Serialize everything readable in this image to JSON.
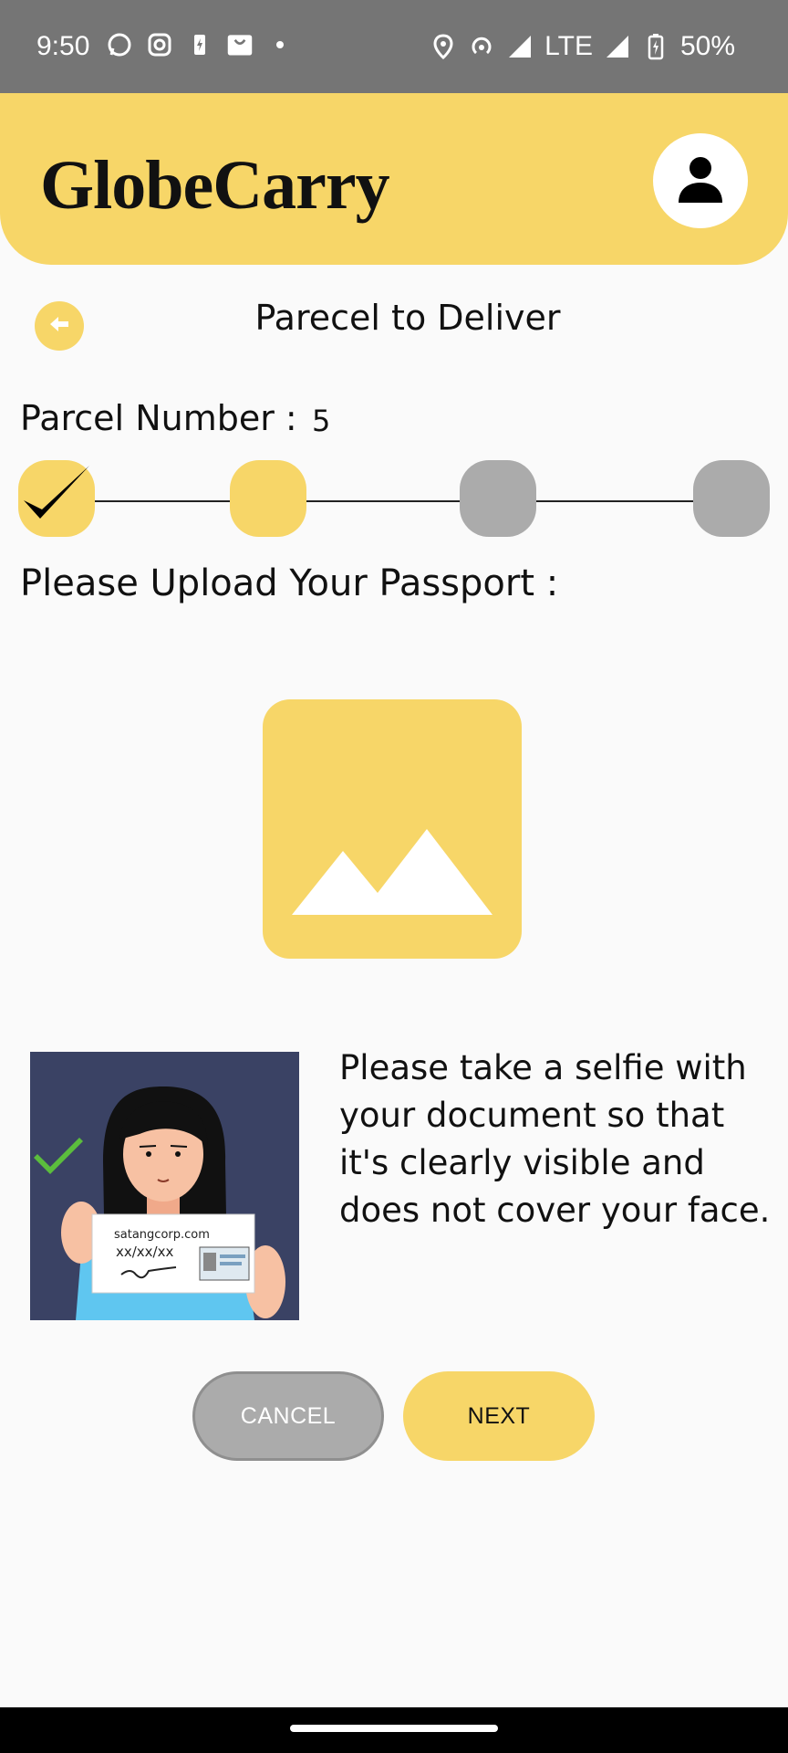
{
  "status_bar": {
    "time": "9:50",
    "network": "LTE",
    "battery": "50%",
    "left_icons": [
      "whatsapp-icon",
      "instagram-icon",
      "battery-saver-icon",
      "shopping-bag-icon",
      "dot-icon"
    ],
    "right_icons": [
      "location-icon",
      "hotspot-icon",
      "signal-icon",
      "signal-icon",
      "battery-icon"
    ]
  },
  "header": {
    "brand": "GlobeCarry",
    "avatar_icon": "person-icon"
  },
  "page": {
    "title": "Parecel to Deliver",
    "back_icon": "arrow-left-icon"
  },
  "parcel": {
    "label": "Parcel Number :",
    "number": "5"
  },
  "stepper": {
    "steps": [
      {
        "state": "completed"
      },
      {
        "state": "current"
      },
      {
        "state": "upcoming"
      },
      {
        "state": "upcoming"
      }
    ]
  },
  "upload": {
    "label": "Please Upload Your Passport :",
    "placeholder_icon": "image-placeholder-icon"
  },
  "selfie": {
    "instruction": "Please take a selfie with your document so that it's clearly visible and does not cover your face.",
    "card_site": "satangcorp.com",
    "card_date": "xx/xx/xx"
  },
  "buttons": {
    "cancel": "CANCEL",
    "next": "NEXT"
  },
  "colors": {
    "accent": "#f7d668",
    "inactive": "#ababab",
    "status_bar": "#757575"
  }
}
